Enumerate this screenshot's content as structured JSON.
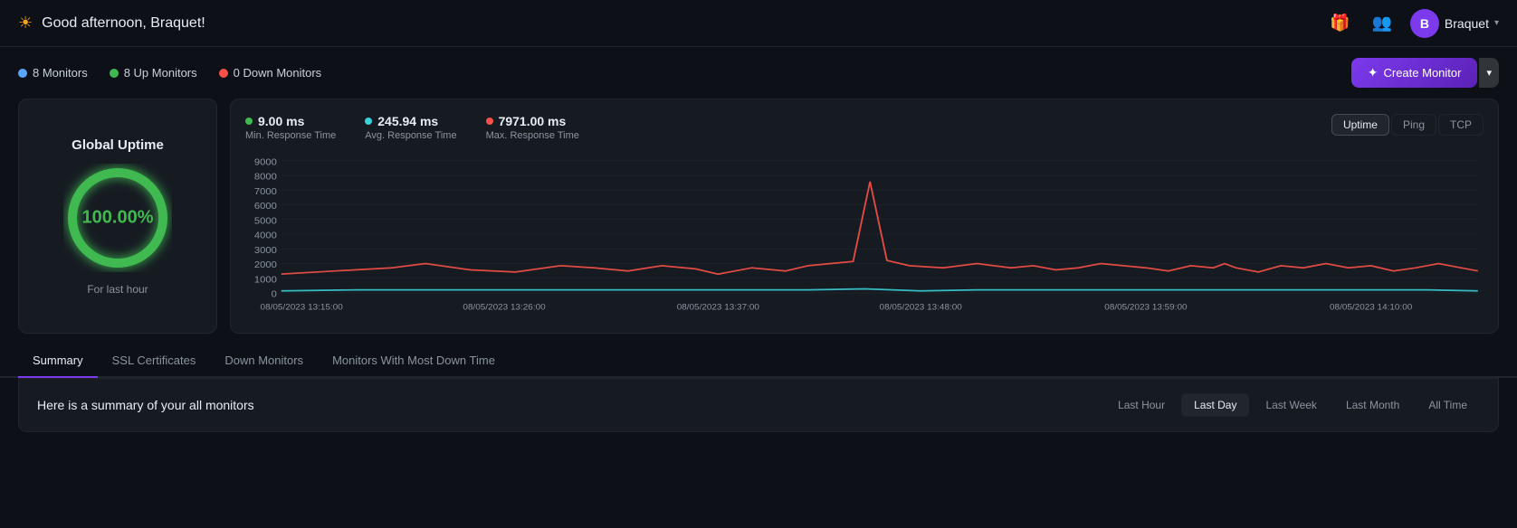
{
  "header": {
    "title": "Good afternoon, Braquet!",
    "sun_icon": "☀",
    "gift_icon": "🎁",
    "team_icon": "👥",
    "user_initial": "B",
    "user_name": "Braquet",
    "chevron": "▾"
  },
  "monitor_stats": {
    "total_label": "8 Monitors",
    "up_label": "8 Up Monitors",
    "down_label": "0 Down Monitors"
  },
  "create_button": {
    "label": "Create Monitor",
    "sparkle": "✦"
  },
  "uptime_card": {
    "title": "Global Uptime",
    "percentage": "100.00%",
    "sub": "For last hour"
  },
  "chart": {
    "min_value": "9.00 ms",
    "min_label": "Min. Response Time",
    "avg_value": "245.94 ms",
    "avg_label": "Avg. Response Time",
    "max_value": "7971.00 ms",
    "max_label": "Max. Response Time",
    "y_labels": [
      "9000",
      "8000",
      "7000",
      "6000",
      "5000",
      "4000",
      "3000",
      "2000",
      "1000",
      "0"
    ],
    "x_labels": [
      "08/05/2023 13:15:00",
      "08/05/2023 13:26:00",
      "08/05/2023 13:37:00",
      "08/05/2023 13:48:00",
      "08/05/2023 13:59:00",
      "08/05/2023 14:10:00"
    ],
    "tabs": [
      "Uptime",
      "Ping",
      "TCP"
    ],
    "active_tab": "Uptime"
  },
  "tabs": {
    "items": [
      "Summary",
      "SSL Certificates",
      "Down Monitors",
      "Monitors With Most Down Time"
    ],
    "active": "Summary"
  },
  "summary": {
    "text": "Here is a summary of your all monitors",
    "time_filters": [
      "Last Hour",
      "Last Day",
      "Last Week",
      "Last Month",
      "All Time"
    ],
    "active_filter": "Last Day"
  }
}
